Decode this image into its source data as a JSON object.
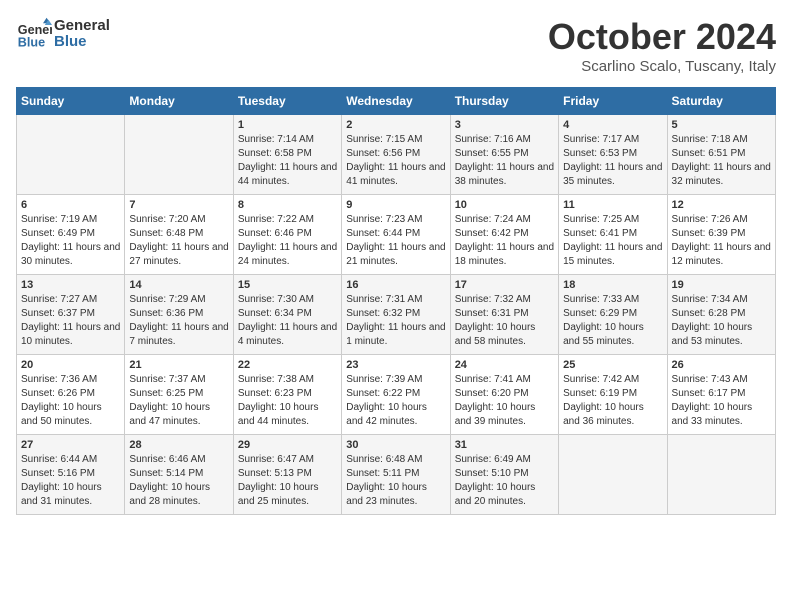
{
  "logo": {
    "line1": "General",
    "line2": "Blue"
  },
  "title": "October 2024",
  "subtitle": "Scarlino Scalo, Tuscany, Italy",
  "days_of_week": [
    "Sunday",
    "Monday",
    "Tuesday",
    "Wednesday",
    "Thursday",
    "Friday",
    "Saturday"
  ],
  "weeks": [
    [
      {
        "day": "",
        "content": ""
      },
      {
        "day": "",
        "content": ""
      },
      {
        "day": "1",
        "content": "Sunrise: 7:14 AM\nSunset: 6:58 PM\nDaylight: 11 hours and 44 minutes."
      },
      {
        "day": "2",
        "content": "Sunrise: 7:15 AM\nSunset: 6:56 PM\nDaylight: 11 hours and 41 minutes."
      },
      {
        "day": "3",
        "content": "Sunrise: 7:16 AM\nSunset: 6:55 PM\nDaylight: 11 hours and 38 minutes."
      },
      {
        "day": "4",
        "content": "Sunrise: 7:17 AM\nSunset: 6:53 PM\nDaylight: 11 hours and 35 minutes."
      },
      {
        "day": "5",
        "content": "Sunrise: 7:18 AM\nSunset: 6:51 PM\nDaylight: 11 hours and 32 minutes."
      }
    ],
    [
      {
        "day": "6",
        "content": "Sunrise: 7:19 AM\nSunset: 6:49 PM\nDaylight: 11 hours and 30 minutes."
      },
      {
        "day": "7",
        "content": "Sunrise: 7:20 AM\nSunset: 6:48 PM\nDaylight: 11 hours and 27 minutes."
      },
      {
        "day": "8",
        "content": "Sunrise: 7:22 AM\nSunset: 6:46 PM\nDaylight: 11 hours and 24 minutes."
      },
      {
        "day": "9",
        "content": "Sunrise: 7:23 AM\nSunset: 6:44 PM\nDaylight: 11 hours and 21 minutes."
      },
      {
        "day": "10",
        "content": "Sunrise: 7:24 AM\nSunset: 6:42 PM\nDaylight: 11 hours and 18 minutes."
      },
      {
        "day": "11",
        "content": "Sunrise: 7:25 AM\nSunset: 6:41 PM\nDaylight: 11 hours and 15 minutes."
      },
      {
        "day": "12",
        "content": "Sunrise: 7:26 AM\nSunset: 6:39 PM\nDaylight: 11 hours and 12 minutes."
      }
    ],
    [
      {
        "day": "13",
        "content": "Sunrise: 7:27 AM\nSunset: 6:37 PM\nDaylight: 11 hours and 10 minutes."
      },
      {
        "day": "14",
        "content": "Sunrise: 7:29 AM\nSunset: 6:36 PM\nDaylight: 11 hours and 7 minutes."
      },
      {
        "day": "15",
        "content": "Sunrise: 7:30 AM\nSunset: 6:34 PM\nDaylight: 11 hours and 4 minutes."
      },
      {
        "day": "16",
        "content": "Sunrise: 7:31 AM\nSunset: 6:32 PM\nDaylight: 11 hours and 1 minute."
      },
      {
        "day": "17",
        "content": "Sunrise: 7:32 AM\nSunset: 6:31 PM\nDaylight: 10 hours and 58 minutes."
      },
      {
        "day": "18",
        "content": "Sunrise: 7:33 AM\nSunset: 6:29 PM\nDaylight: 10 hours and 55 minutes."
      },
      {
        "day": "19",
        "content": "Sunrise: 7:34 AM\nSunset: 6:28 PM\nDaylight: 10 hours and 53 minutes."
      }
    ],
    [
      {
        "day": "20",
        "content": "Sunrise: 7:36 AM\nSunset: 6:26 PM\nDaylight: 10 hours and 50 minutes."
      },
      {
        "day": "21",
        "content": "Sunrise: 7:37 AM\nSunset: 6:25 PM\nDaylight: 10 hours and 47 minutes."
      },
      {
        "day": "22",
        "content": "Sunrise: 7:38 AM\nSunset: 6:23 PM\nDaylight: 10 hours and 44 minutes."
      },
      {
        "day": "23",
        "content": "Sunrise: 7:39 AM\nSunset: 6:22 PM\nDaylight: 10 hours and 42 minutes."
      },
      {
        "day": "24",
        "content": "Sunrise: 7:41 AM\nSunset: 6:20 PM\nDaylight: 10 hours and 39 minutes."
      },
      {
        "day": "25",
        "content": "Sunrise: 7:42 AM\nSunset: 6:19 PM\nDaylight: 10 hours and 36 minutes."
      },
      {
        "day": "26",
        "content": "Sunrise: 7:43 AM\nSunset: 6:17 PM\nDaylight: 10 hours and 33 minutes."
      }
    ],
    [
      {
        "day": "27",
        "content": "Sunrise: 6:44 AM\nSunset: 5:16 PM\nDaylight: 10 hours and 31 minutes."
      },
      {
        "day": "28",
        "content": "Sunrise: 6:46 AM\nSunset: 5:14 PM\nDaylight: 10 hours and 28 minutes."
      },
      {
        "day": "29",
        "content": "Sunrise: 6:47 AM\nSunset: 5:13 PM\nDaylight: 10 hours and 25 minutes."
      },
      {
        "day": "30",
        "content": "Sunrise: 6:48 AM\nSunset: 5:11 PM\nDaylight: 10 hours and 23 minutes."
      },
      {
        "day": "31",
        "content": "Sunrise: 6:49 AM\nSunset: 5:10 PM\nDaylight: 10 hours and 20 minutes."
      },
      {
        "day": "",
        "content": ""
      },
      {
        "day": "",
        "content": ""
      }
    ]
  ]
}
